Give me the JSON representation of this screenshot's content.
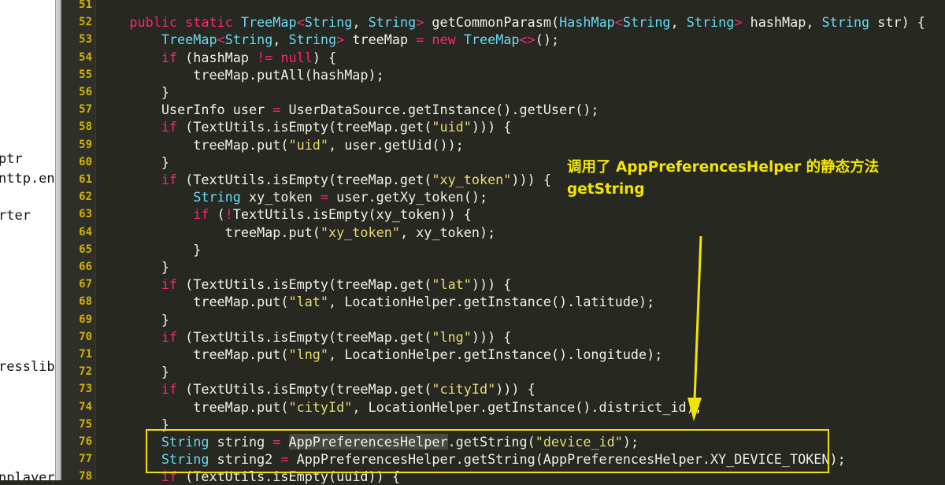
{
  "project_panel": {
    "items": [
      "ptr",
      "nttp.en",
      "rter",
      "resslib",
      "nplayer"
    ]
  },
  "editor": {
    "lines": [
      {
        "n": "51",
        "segs": []
      },
      {
        "n": "52",
        "segs": [
          [
            "    "
          ],
          [
            "public static ",
            "kw"
          ],
          [
            "TreeMap",
            "ty"
          ],
          [
            "<",
            "kw"
          ],
          [
            "String",
            "ty"
          ],
          [
            ", "
          ],
          [
            "String",
            "ty"
          ],
          [
            "> ",
            "kw"
          ],
          [
            "getCommonParasm("
          ],
          [
            "HashMap",
            "ty"
          ],
          [
            "<",
            "kw"
          ],
          [
            "String",
            "ty"
          ],
          [
            ", "
          ],
          [
            "String",
            "ty"
          ],
          [
            "> ",
            "kw"
          ],
          [
            "hashMap, "
          ],
          [
            "String",
            "ty"
          ],
          [
            " str) {"
          ]
        ]
      },
      {
        "n": "53",
        "segs": [
          [
            "        "
          ],
          [
            "TreeMap",
            "ty"
          ],
          [
            "<",
            "kw"
          ],
          [
            "String",
            "ty"
          ],
          [
            ", "
          ],
          [
            "String",
            "ty"
          ],
          [
            "> ",
            "kw"
          ],
          [
            "treeMap "
          ],
          [
            "= new ",
            "kw"
          ],
          [
            "TreeMap",
            "ty"
          ],
          [
            "<>",
            "kw"
          ],
          [
            "();"
          ]
        ]
      },
      {
        "n": "54",
        "segs": [
          [
            "        "
          ],
          [
            "if",
            "kw"
          ],
          [
            " (hashMap "
          ],
          [
            "!= null",
            "kw"
          ],
          [
            ") {"
          ]
        ]
      },
      {
        "n": "55",
        "segs": [
          [
            "            treeMap.putAll(hashMap);"
          ]
        ]
      },
      {
        "n": "56",
        "segs": [
          [
            "        }"
          ]
        ]
      },
      {
        "n": "57",
        "segs": [
          [
            "        UserInfo user "
          ],
          [
            "=",
            "kw"
          ],
          [
            " UserDataSource.getInstance().getUser();"
          ]
        ]
      },
      {
        "n": "58",
        "segs": [
          [
            "        "
          ],
          [
            "if",
            "kw"
          ],
          [
            " (TextUtils.isEmpty(treeMap.get("
          ],
          [
            "\"uid\"",
            "st"
          ],
          [
            "))) {"
          ]
        ]
      },
      {
        "n": "59",
        "segs": [
          [
            "            treeMap.put("
          ],
          [
            "\"uid\"",
            "st"
          ],
          [
            ", user.getUid());"
          ]
        ]
      },
      {
        "n": "60",
        "segs": [
          [
            "        }"
          ]
        ]
      },
      {
        "n": "61",
        "segs": [
          [
            "        "
          ],
          [
            "if",
            "kw"
          ],
          [
            " (TextUtils.isEmpty(treeMap.get("
          ],
          [
            "\"xy_token\"",
            "st"
          ],
          [
            "))) {"
          ]
        ]
      },
      {
        "n": "62",
        "segs": [
          [
            "            "
          ],
          [
            "String",
            "ty"
          ],
          [
            " xy_token "
          ],
          [
            "=",
            "kw"
          ],
          [
            " user.getXy_token();"
          ]
        ]
      },
      {
        "n": "63",
        "segs": [
          [
            "            "
          ],
          [
            "if",
            "kw"
          ],
          [
            " ("
          ],
          [
            "!",
            "kw"
          ],
          [
            "TextUtils.isEmpty(xy_token)) {"
          ]
        ]
      },
      {
        "n": "64",
        "segs": [
          [
            "                treeMap.put("
          ],
          [
            "\"xy_token\"",
            "st"
          ],
          [
            ", xy_token);"
          ]
        ]
      },
      {
        "n": "65",
        "segs": [
          [
            "            }"
          ]
        ]
      },
      {
        "n": "66",
        "segs": [
          [
            "        }"
          ]
        ]
      },
      {
        "n": "67",
        "segs": [
          [
            "        "
          ],
          [
            "if",
            "kw"
          ],
          [
            " (TextUtils.isEmpty(treeMap.get("
          ],
          [
            "\"lat\"",
            "st"
          ],
          [
            "))) {"
          ]
        ]
      },
      {
        "n": "68",
        "segs": [
          [
            "            treeMap.put("
          ],
          [
            "\"lat\"",
            "st"
          ],
          [
            ", LocationHelper.getInstance().latitude);"
          ]
        ]
      },
      {
        "n": "69",
        "segs": [
          [
            "        }"
          ]
        ]
      },
      {
        "n": "70",
        "segs": [
          [
            "        "
          ],
          [
            "if",
            "kw"
          ],
          [
            " (TextUtils.isEmpty(treeMap.get("
          ],
          [
            "\"lng\"",
            "st"
          ],
          [
            "))) {"
          ]
        ]
      },
      {
        "n": "71",
        "segs": [
          [
            "            treeMap.put("
          ],
          [
            "\"lng\"",
            "st"
          ],
          [
            ", LocationHelper.getInstance().longitude);"
          ]
        ]
      },
      {
        "n": "72",
        "segs": [
          [
            "        }"
          ]
        ]
      },
      {
        "n": "73",
        "segs": [
          [
            "        "
          ],
          [
            "if",
            "kw"
          ],
          [
            " (TextUtils.isEmpty(treeMap.get("
          ],
          [
            "\"cityId\"",
            "st"
          ],
          [
            "))) {"
          ]
        ]
      },
      {
        "n": "74",
        "segs": [
          [
            "            treeMap.put("
          ],
          [
            "\"cityId\"",
            "st"
          ],
          [
            ", LocationHelper.getInstance().district_id);"
          ]
        ]
      },
      {
        "n": "75",
        "segs": [
          [
            "        }"
          ]
        ]
      },
      {
        "n": "76",
        "segs": [
          [
            "        "
          ],
          [
            "String",
            "ty"
          ],
          [
            " string "
          ],
          [
            "=",
            "kw"
          ],
          [
            " "
          ],
          [
            "AppPreferencesHelper",
            "hl"
          ],
          [
            ".getString("
          ],
          [
            "\"device_id\"",
            "st"
          ],
          [
            ");"
          ]
        ]
      },
      {
        "n": "77",
        "segs": [
          [
            "        "
          ],
          [
            "String",
            "ty"
          ],
          [
            " string2 "
          ],
          [
            "=",
            "kw"
          ],
          [
            " AppPreferencesHelper.getString(AppPreferencesHelper.XY_DEVICE_TOKEN);"
          ]
        ]
      },
      {
        "n": "78",
        "segs": [
          [
            "        "
          ],
          [
            "if",
            "kw"
          ],
          [
            " (TextUtils.isEmpty(uuid)) {"
          ]
        ]
      }
    ]
  },
  "annotation": {
    "text": "调用了 AppPreferencesHelper 的静态方法\ngetString"
  },
  "colors": {
    "background": "#272822",
    "keyword": "#f92672",
    "type": "#66d9ef",
    "string": "#e6db74",
    "line_number": "#d4b200",
    "annotation": "#f2e600"
  }
}
